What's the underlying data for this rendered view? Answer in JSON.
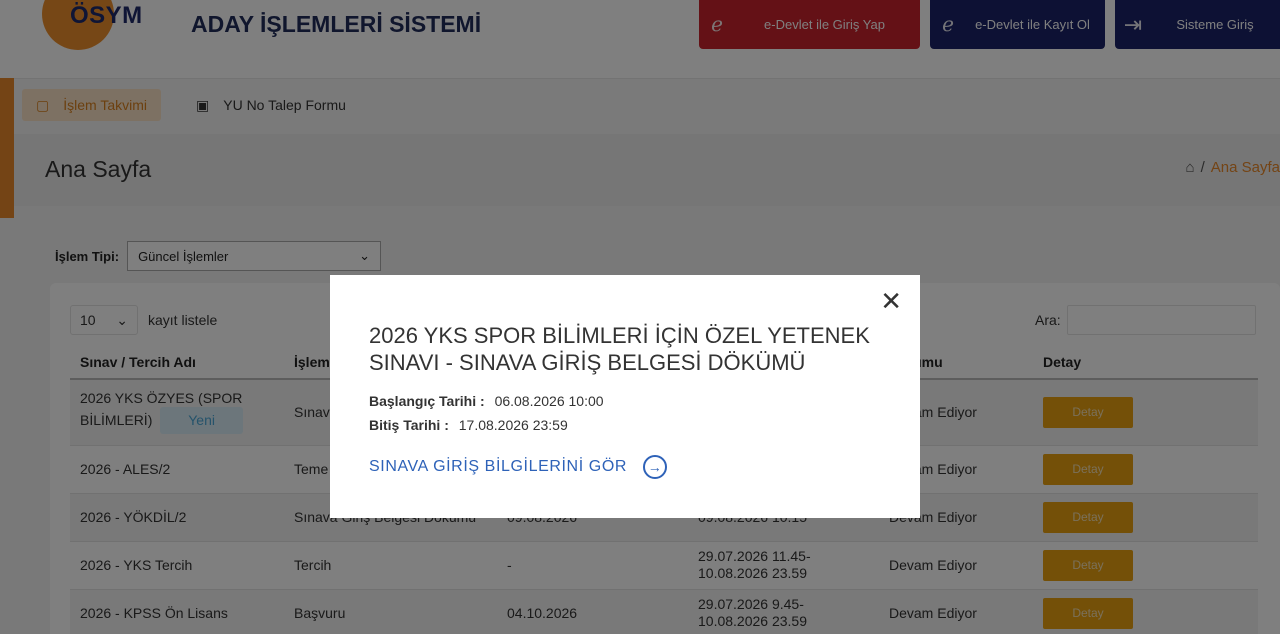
{
  "header": {
    "logo_text": "ÖSYM",
    "title": "ADAY İŞLEMLERİ SİSTEMİ",
    "btn_edevlet_login": "e-Devlet ile Giriş Yap",
    "btn_edevlet_register": "e-Devlet ile Kayıt Ol",
    "btn_login": "Sisteme Giriş"
  },
  "nav": {
    "items": [
      {
        "label": "İşlem Takvimi"
      },
      {
        "label": "YU No Talep Formu"
      }
    ]
  },
  "page": {
    "title": "Ana Sayfa",
    "breadcrumb_current": "Ana Sayfa",
    "breadcrumb_sep": "/"
  },
  "filter": {
    "label": "İşlem Tipi:",
    "selected": "Güncel İşlemler"
  },
  "table": {
    "length_value": "10",
    "length_suffix": "kayıt listele",
    "search_label": "Ara:",
    "columns": [
      "Sınav / Tercih Adı",
      "İşlem",
      "",
      "",
      "Durumu",
      "Detay"
    ],
    "new_badge": "Yeni",
    "detail_label": "Detay",
    "rows": [
      {
        "name": "2026 YKS ÖZYES (SPOR BİLİMLERİ)",
        "islem": "Sınav",
        "c3": "",
        "c4": "",
        "status": "Devam Ediyor"
      },
      {
        "name": "2026 - ALES/2",
        "islem": "Teme Görün",
        "c3": "",
        "c4": "",
        "status": "Devam Ediyor"
      },
      {
        "name": "2026 - YÖKDİL/2",
        "islem": "Sınava Giriş Belgesi Dökümü",
        "c3": "09.08.2026",
        "c4": "09.08.2026 10.15",
        "status": "Devam Ediyor"
      },
      {
        "name": "2026 - YKS Tercih",
        "islem": "Tercih",
        "c3": "-",
        "c4": "29.07.2026 11.45- 10.08.2026 23.59",
        "status": "Devam Ediyor"
      },
      {
        "name": "2026 - KPSS Ön Lisans",
        "islem": "Başvuru",
        "c3": "04.10.2026",
        "c4": "29.07.2026 9.45- 10.08.2026 23.59",
        "status": "Devam Ediyor"
      }
    ]
  },
  "modal": {
    "title": "2026 YKS SPOR BİLİMLERİ İÇİN ÖZEL YETENEK SINAVI - SINAVA GİRİŞ BELGESİ DÖKÜMÜ",
    "start_label": "Başlangıç Tarihi :",
    "start_value": "06.08.2026 10:00",
    "end_label": "Bitiş Tarihi :",
    "end_value": "17.08.2026 23:59",
    "link_label": "SINAVA GİRİŞ BİLGİLERİNİ GÖR"
  }
}
